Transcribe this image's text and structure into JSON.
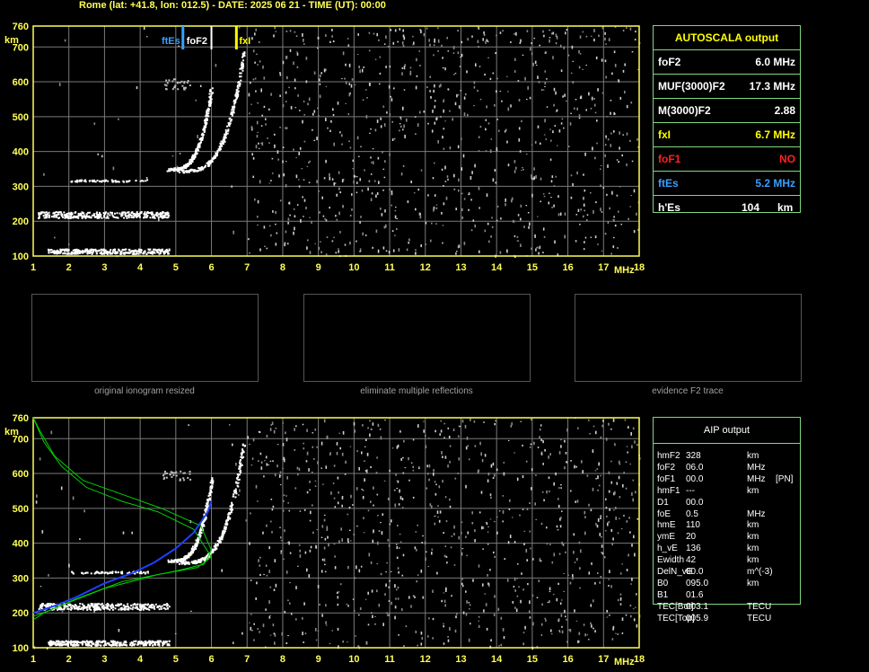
{
  "header": "Rome (lat: +41.8, lon: 012.5) - DATE: 2025 06 21 - TIME (UT): 00:00",
  "colors": {
    "axis": "#ffff55",
    "grid": "#7a7a7a",
    "panel_border": "#7fd87f",
    "ftEs": "#3aa0ff",
    "foF2": "#ffffff",
    "fxI": "#ffff00",
    "foF1": "#ff2020",
    "profile_green": "#00d000",
    "profile_blue": "#2040ff"
  },
  "axes": {
    "x_ticks": [
      "1",
      "2",
      "3",
      "4",
      "5",
      "6",
      "7",
      "8",
      "9",
      "10",
      "11",
      "12",
      "13",
      "14",
      "15",
      "16",
      "17",
      "18"
    ],
    "x_unit": "MHz",
    "y_ticks": [
      "100",
      "200",
      "300",
      "400",
      "500",
      "600",
      "700",
      "760"
    ],
    "y_unit": "km"
  },
  "markers": {
    "ftEs": "ftEs",
    "foF2": "foF2",
    "fxI": "fxI"
  },
  "autoscala": {
    "title": "AUTOSCALA output",
    "rows": [
      {
        "label": "foF2",
        "value": "6.0 MHz",
        "color": "#ffffff"
      },
      {
        "label": "MUF(3000)F2",
        "value": "17.3 MHz",
        "color": "#ffffff"
      },
      {
        "label": "M(3000)F2",
        "value": "2.88",
        "color": "#ffffff"
      },
      {
        "label": "fxI",
        "value": "6.7 MHz",
        "color": "#ffff00"
      },
      {
        "label": "foF1",
        "value": "NO",
        "color": "#ff2020"
      },
      {
        "label": "ftEs",
        "value": "5.2 MHz",
        "color": "#3aa0ff"
      },
      {
        "label": "h'Es",
        "value": "104",
        "unit": "km",
        "color": "#ffffff"
      }
    ]
  },
  "thumbnails": [
    {
      "caption": "original ionogram resized"
    },
    {
      "caption": "eliminate multiple reflections"
    },
    {
      "caption": "evidence F2 trace"
    }
  ],
  "aip": {
    "title": "AIP output",
    "rows": [
      {
        "label": "hmF2",
        "value": "328",
        "unit": "km"
      },
      {
        "label": "foF2",
        "value": "06.0",
        "unit": "MHz"
      },
      {
        "label": "foF1",
        "value": "00.0",
        "unit": "MHz",
        "extra": "[PN]"
      },
      {
        "label": "hmF1",
        "value": "---",
        "unit": "km"
      },
      {
        "label": "D1",
        "value": "00.0",
        "unit": ""
      },
      {
        "label": "foE",
        "value": "0.5",
        "unit": "MHz"
      },
      {
        "label": "hmE",
        "value": "110",
        "unit": "km"
      },
      {
        "label": "ymE",
        "value": "20",
        "unit": "km"
      },
      {
        "label": "h_vE",
        "value": "136",
        "unit": "km"
      },
      {
        "label": "Ewidth",
        "value": "42",
        "unit": "km"
      },
      {
        "label": "DelN_vE",
        "value": "00.0",
        "unit": "m^(-3)"
      },
      {
        "label": "B0",
        "value": "095.0",
        "unit": "km"
      },
      {
        "label": "B1",
        "value": "01.6",
        "unit": ""
      },
      {
        "label": "TEC[Bot]",
        "value": "003.1",
        "unit": "TECU"
      },
      {
        "label": "TEC[Top]",
        "value": "005.9",
        "unit": "TECU"
      }
    ]
  }
}
